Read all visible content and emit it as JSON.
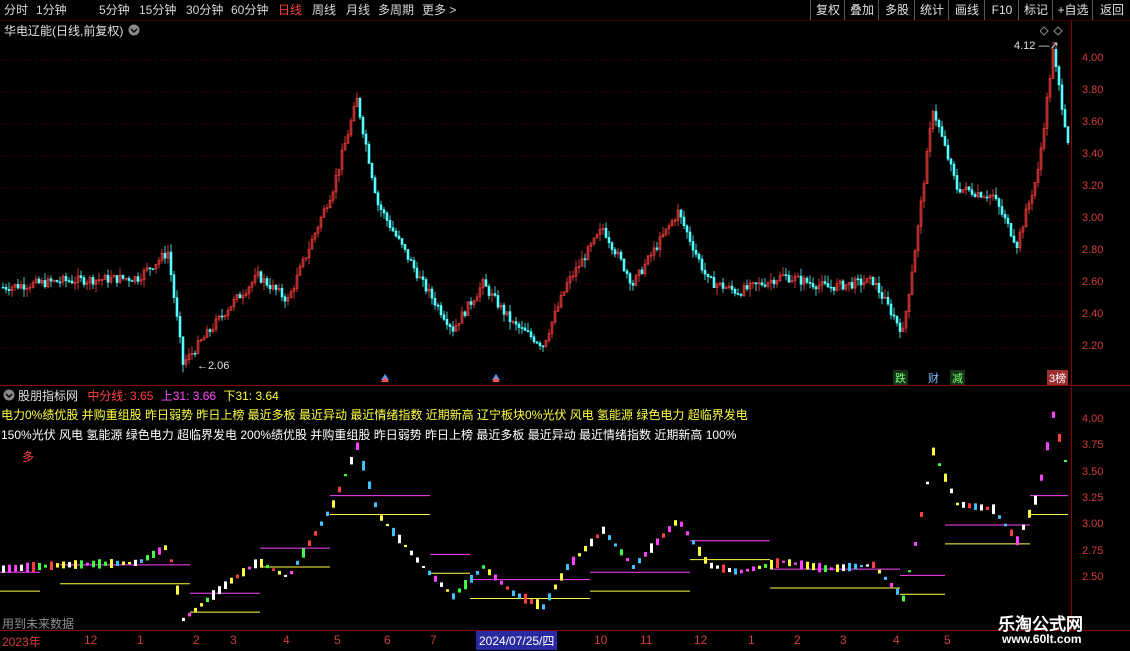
{
  "toolbar": {
    "periods": [
      "分时",
      "1分钟",
      "5分钟",
      "15分钟",
      "30分钟",
      "60分钟",
      "日线",
      "周线",
      "月线",
      "多周期",
      "更多 >"
    ],
    "active_period": "日线",
    "right_buttons": [
      "复权",
      "叠加",
      "多股",
      "统计",
      "画线",
      "F10",
      "标记",
      "+自选",
      "返回"
    ]
  },
  "main_chart": {
    "title": "华电辽能(日线,前复权)",
    "y_ticks": [
      "4.00",
      "3.80",
      "3.60",
      "3.40",
      "3.20",
      "3.00",
      "2.80",
      "2.60",
      "2.40",
      "2.20"
    ],
    "high_label": "4.12",
    "low_label": "2.06",
    "markers": [
      "跌",
      "财",
      "减",
      "3榜"
    ],
    "colors": {
      "up": "#ff4040",
      "down": "#54ffff"
    }
  },
  "indicator": {
    "title": "股朋指标网",
    "mid_label": "中分线: 3.65",
    "up_label": "上31: 3.66",
    "down_label": "下31: 3.64",
    "line1": "电力0%绩优股 并购重组股 昨日弱势 昨日上榜 最近多板 最近异动 最近情绪指数 近期新高 辽宁板块0%光伏 风电 氢能源 绿色电力 超临界发电",
    "line2": "150%光伏 风电 氢能源 绿色电力 超临界发电 200%绩优股 并购重组股 昨日弱势 昨日上榜 最近多板 最近异动 最近情绪指数 近期新高 100%",
    "duo_label": "多",
    "bottom_note": "用到未来数据",
    "y_ticks": [
      "4.00",
      "3.75",
      "3.50",
      "3.25",
      "3.00",
      "2.75",
      "2.50"
    ]
  },
  "date_axis": {
    "labels": [
      "2023年",
      "12",
      "1",
      "2",
      "3",
      "4",
      "5",
      "6",
      "7",
      "2024/07/25/四",
      "10",
      "11",
      "12",
      "1",
      "2",
      "3",
      "4",
      "5"
    ]
  },
  "watermark": {
    "name": "乐淘公式网",
    "url": "www.60lt.com"
  }
}
